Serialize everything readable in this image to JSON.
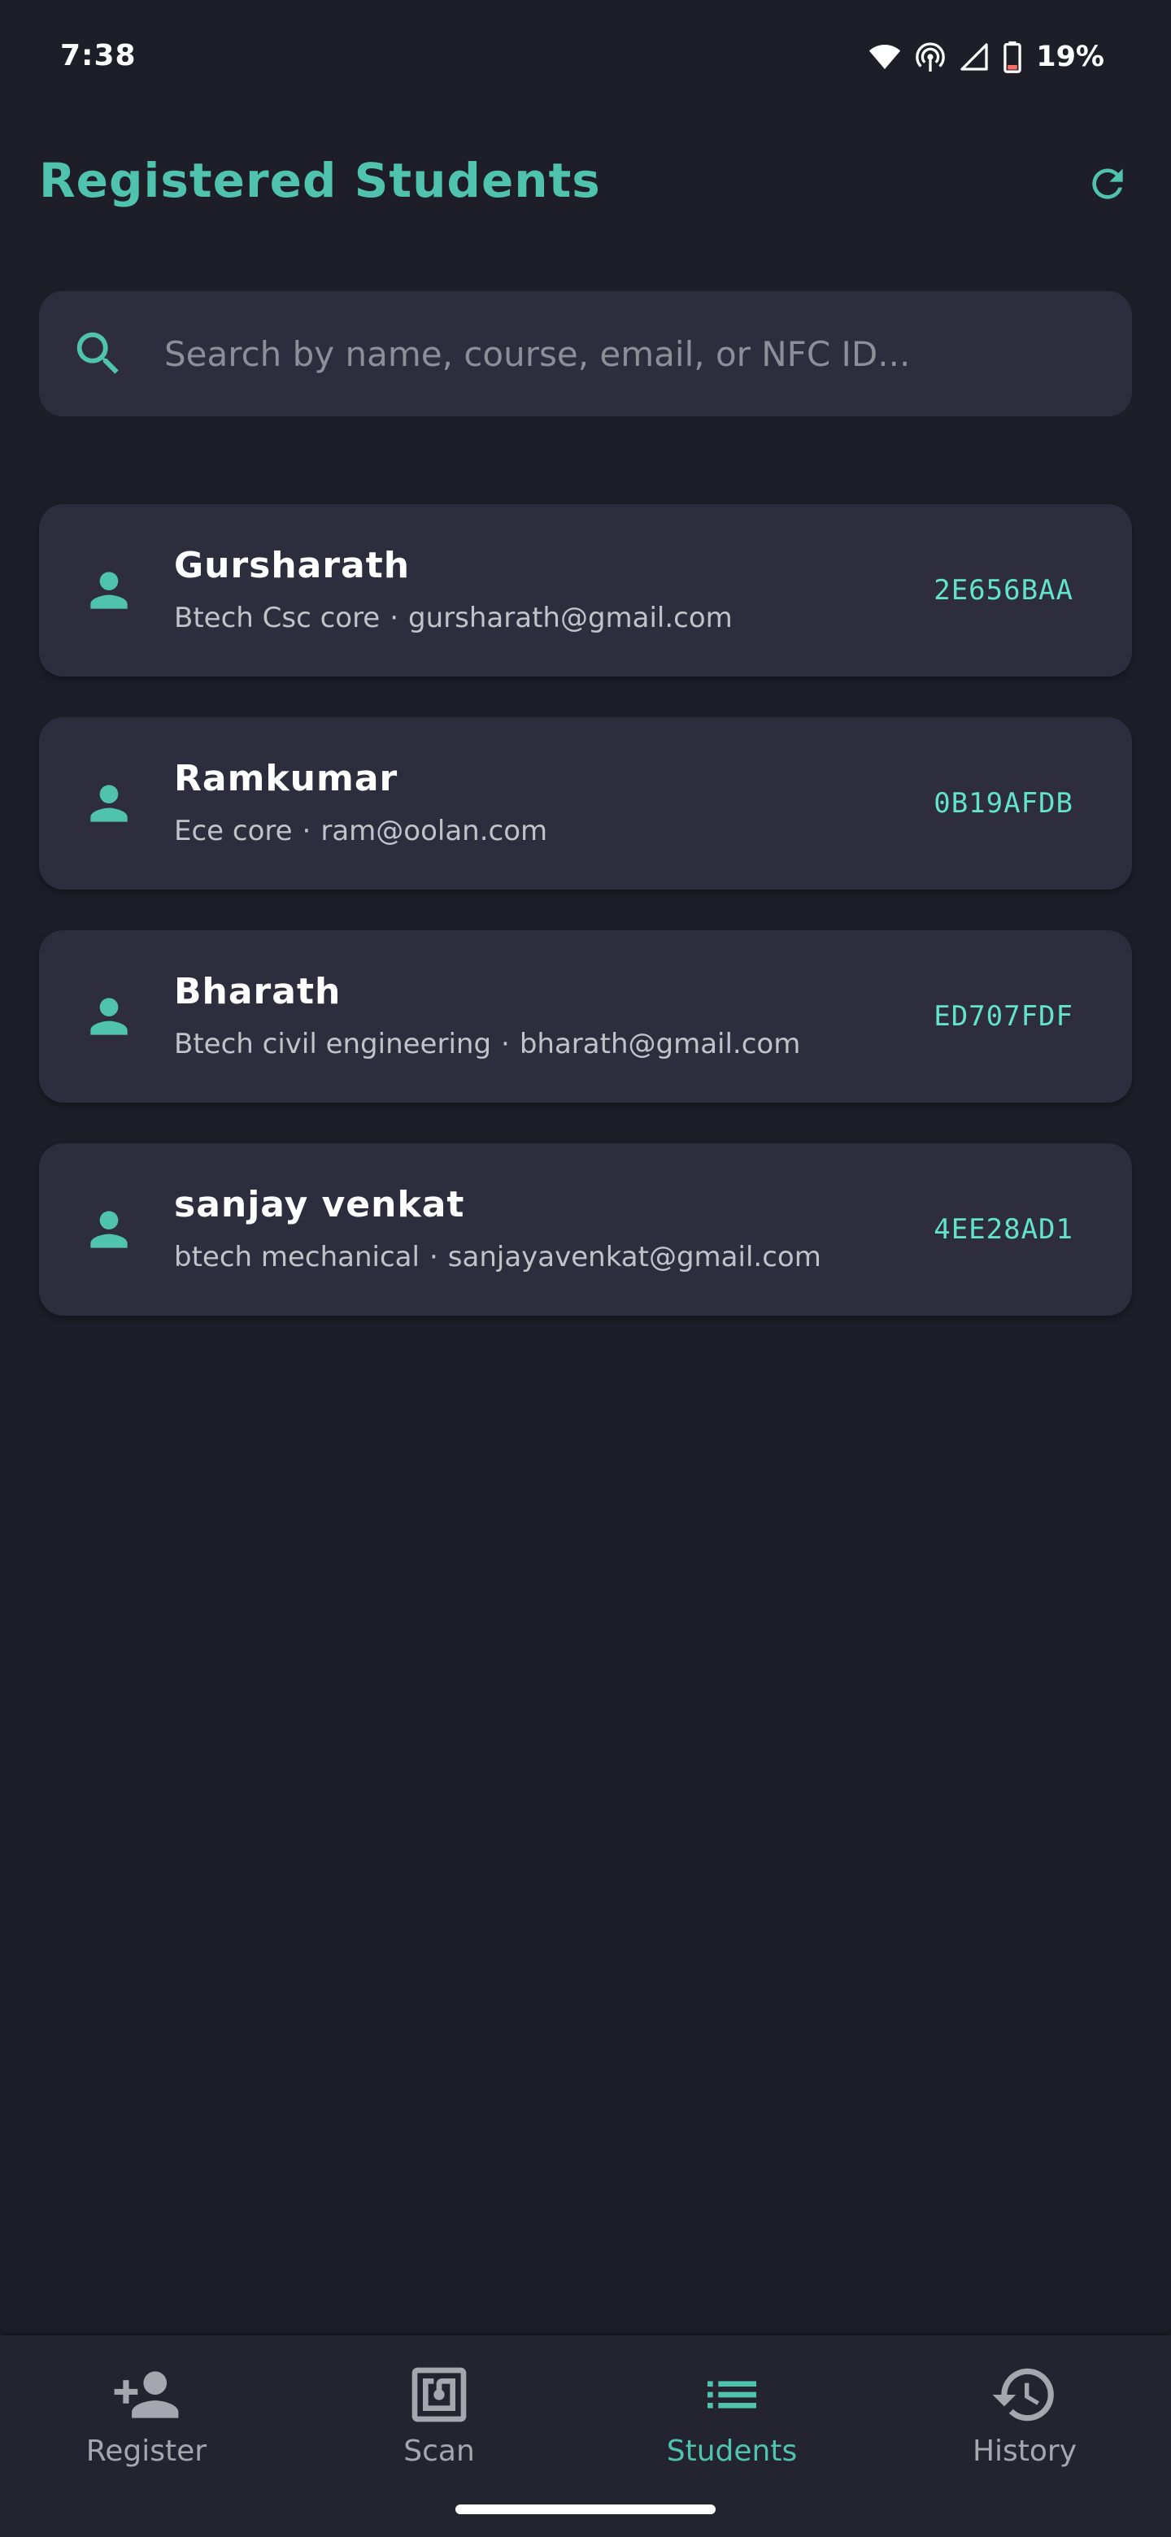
{
  "status_bar": {
    "time": "7:38",
    "battery": "19%",
    "icons": [
      "wifi-icon",
      "hotspot-icon",
      "signal-icon",
      "battery-low-icon"
    ]
  },
  "header": {
    "title": "Registered Students",
    "refresh_icon": "refresh-icon"
  },
  "search": {
    "placeholder": "Search by name, course, email, or NFC ID...",
    "value": ""
  },
  "students": [
    {
      "name": "Gursharath",
      "course": "Btech Csc core",
      "email": "gursharath@gmail.com",
      "nfc_id": "2E656BAA"
    },
    {
      "name": "Ramkumar",
      "course": "Ece core",
      "email": "ram@oolan.com",
      "nfc_id": "0B19AFDB"
    },
    {
      "name": "Bharath",
      "course": "Btech civil engineering",
      "email": "bharath@gmail.com",
      "nfc_id": "ED707FDF"
    },
    {
      "name": "sanjay venkat",
      "course": "btech mechanical",
      "email": "sanjayavenkat@gmail.com",
      "nfc_id": "4EE28AD1"
    }
  ],
  "separator": "·",
  "bottom_nav": {
    "items": [
      {
        "label": "Register",
        "icon": "add-person-icon",
        "active": false
      },
      {
        "label": "Scan",
        "icon": "nfc-icon",
        "active": false
      },
      {
        "label": "Students",
        "icon": "list-icon",
        "active": true
      },
      {
        "label": "History",
        "icon": "history-icon",
        "active": false
      }
    ]
  },
  "colors": {
    "background": "#1e1e29",
    "card": "#2d2d3d",
    "accent": "#4fc3ad",
    "nfc_text": "#64e3cc",
    "nav_inactive": "#a6a6ae"
  }
}
